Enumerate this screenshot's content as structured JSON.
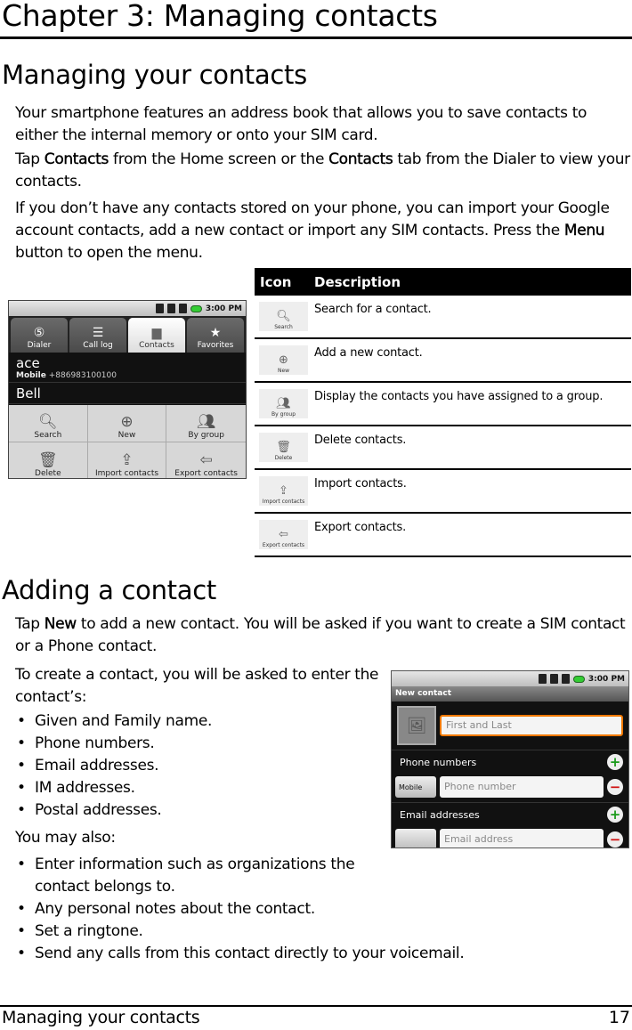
{
  "chapter_title": "Chapter 3: Managing contacts",
  "section1": {
    "heading": "Managing your contacts",
    "p1": "Your smartphone features an address book that allows you to save contacts to either the internal memory or onto your SIM card.",
    "p2": {
      "a": "Tap ",
      "b1": "Contacts",
      "c": " from the Home screen or the ",
      "b2": "Contacts",
      "d": " tab from the Dialer to view your contacts."
    },
    "p3": {
      "a": "If you don’t have any contacts stored on your phone, you can import your Google account contacts, add a new contact or import any SIM contacts. Press the ",
      "b": "Menu",
      "c": " button to open the menu."
    }
  },
  "phone1": {
    "status_time": "3:00 PM",
    "tabs": [
      {
        "label": "Dialer",
        "icon": "dialer-icon"
      },
      {
        "label": "Call log",
        "icon": "call-log-icon"
      },
      {
        "label": "Contacts",
        "icon": "contacts-folder-icon",
        "active": true
      },
      {
        "label": "Favorites",
        "icon": "star-icon"
      }
    ],
    "contacts": [
      {
        "name": "ace",
        "type": "Mobile",
        "number": "+886983100100"
      },
      {
        "name": "Bell"
      }
    ],
    "menu": [
      {
        "label": "Search",
        "icon": "search-icon"
      },
      {
        "label": "New",
        "icon": "plus-icon"
      },
      {
        "label": "By group",
        "icon": "group-icon"
      },
      {
        "label": "Delete",
        "icon": "trash-icon"
      },
      {
        "label": "Import contacts",
        "icon": "import-icon"
      },
      {
        "label": "Export contacts",
        "icon": "export-icon"
      }
    ]
  },
  "table": {
    "headers": [
      "Icon",
      "Description"
    ],
    "rows": [
      {
        "icon_label": "Search",
        "icon": "search-icon",
        "description": "Search for a contact."
      },
      {
        "icon_label": "New",
        "icon": "plus-icon",
        "description": "Add a new contact."
      },
      {
        "icon_label": "By group",
        "icon": "group-icon",
        "description": "Display the contacts you have assigned to a group."
      },
      {
        "icon_label": "Delete",
        "icon": "trash-icon",
        "description": "Delete contacts."
      },
      {
        "icon_label": "Import contacts",
        "icon": "import-icon",
        "description": "Import contacts."
      },
      {
        "icon_label": "Export contacts",
        "icon": "export-icon",
        "description": "Export contacts."
      }
    ]
  },
  "section2": {
    "heading": "Adding a contact",
    "p1": {
      "a": "Tap ",
      "b": "New",
      "c": " to add a new contact. You will be asked if you want to create a SIM contact or a Phone contact."
    },
    "p2": "To create a contact, you will be asked to enter the contact’s:",
    "list1": [
      "Given and Family name.",
      "Phone numbers.",
      "Email addresses.",
      "IM addresses.",
      "Postal addresses."
    ],
    "p3": "You may also:",
    "list2": [
      "Enter information such as organizations the contact belongs to.",
      "Any personal notes about the contact.",
      "Set a ringtone.",
      "Send any calls from this contact directly to your voicemail."
    ]
  },
  "phone2": {
    "status_time": "3:00 PM",
    "title": "New contact",
    "name_placeholder": "First and Last",
    "phone_section": "Phone numbers",
    "phone_type": "Mobile",
    "phone_placeholder": "Phone number",
    "email_section": "Email addresses",
    "email_placeholder": "Email address"
  },
  "footer": {
    "section": "Managing your contacts",
    "page_number": "17"
  },
  "colors": {
    "focus_orange": "#f07800",
    "add_green": "#1a9a1a",
    "remove_red": "#d01010"
  }
}
